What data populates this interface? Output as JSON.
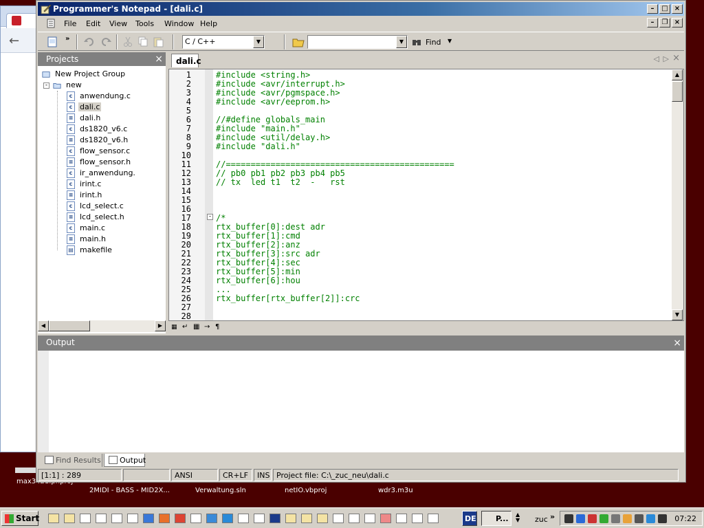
{
  "window": {
    "title": "Programmer's Notepad - [dali.c]"
  },
  "menu": [
    "File",
    "Edit",
    "View",
    "Tools",
    "Window",
    "Help"
  ],
  "toolbar": {
    "language": "C / C++",
    "find_value": "",
    "find_label": "Find"
  },
  "projects": {
    "header": "Projects",
    "group": "New Project Group",
    "project": "new",
    "files": [
      {
        "name": "anwendung.c",
        "type": "c"
      },
      {
        "name": "dali.c",
        "type": "c"
      },
      {
        "name": "dali.h",
        "type": "h"
      },
      {
        "name": "ds1820_v6.c",
        "type": "c"
      },
      {
        "name": "ds1820_v6.h",
        "type": "h"
      },
      {
        "name": "flow_sensor.c",
        "type": "c"
      },
      {
        "name": "flow_sensor.h",
        "type": "h"
      },
      {
        "name": "ir_anwendung.",
        "type": "c"
      },
      {
        "name": "irint.c",
        "type": "c"
      },
      {
        "name": "irint.h",
        "type": "h"
      },
      {
        "name": "lcd_select.c",
        "type": "c"
      },
      {
        "name": "lcd_select.h",
        "type": "h"
      },
      {
        "name": "main.c",
        "type": "c"
      },
      {
        "name": "main.h",
        "type": "h"
      },
      {
        "name": "makefile",
        "type": "make"
      }
    ]
  },
  "editor": {
    "tab": "dali.c",
    "lines": [
      "#include <string.h>",
      "#include <avr/interrupt.h>",
      "#include <avr/pgmspace.h>",
      "#include <avr/eeprom.h>",
      "",
      "//#define globals_main",
      "#include \"main.h\"",
      "#include <util/delay.h>",
      "#include \"dali.h\"",
      "",
      "//==============================================",
      "// pb0 pb1 pb2 pb3 pb4 pb5",
      "// tx  led t1  t2  -   rst",
      "",
      "",
      "",
      "/*",
      "rtx_buffer[0]:dest adr",
      "rtx_buffer[1]:cmd",
      "rtx_buffer[2]:anz",
      "rtx_buffer[3]:src adr",
      "rtx_buffer[4]:sec",
      "rtx_buffer[5]:min",
      "rtx_buffer[6]:hou",
      "...",
      "rtx_buffer[rtx_buffer[2]]:crc",
      "",
      ""
    ],
    "line_numbers": [
      "1",
      "2",
      "3",
      "4",
      "5",
      "6",
      "7",
      "8",
      "9",
      "10",
      "11",
      "12",
      "13",
      "14",
      "15",
      "16",
      "17",
      "18",
      "19",
      "20",
      "21",
      "22",
      "23",
      "24",
      "25",
      "26",
      "27",
      "28"
    ]
  },
  "output": {
    "header": "Output"
  },
  "bottom_tabs": [
    "Find Results",
    "Output"
  ],
  "status": {
    "position": "[1:1] : 289",
    "encoding": "ANSI",
    "line_ending": "CR+LF",
    "mode": "INS",
    "project_file": "Project file: C:\\_zuc_neu\\dali.c"
  },
  "desktop": {
    "labels": [
      "max3421.pnproj",
      "2MIDI - BASS - MID2X...",
      "Verwaltung.sln",
      "netIO.vbproj",
      "wdr3.m3u"
    ]
  },
  "taskbar": {
    "start": "Start",
    "active_task": "P...",
    "toolbar_label": "zuc",
    "language": "DE",
    "clock": "07:22"
  }
}
